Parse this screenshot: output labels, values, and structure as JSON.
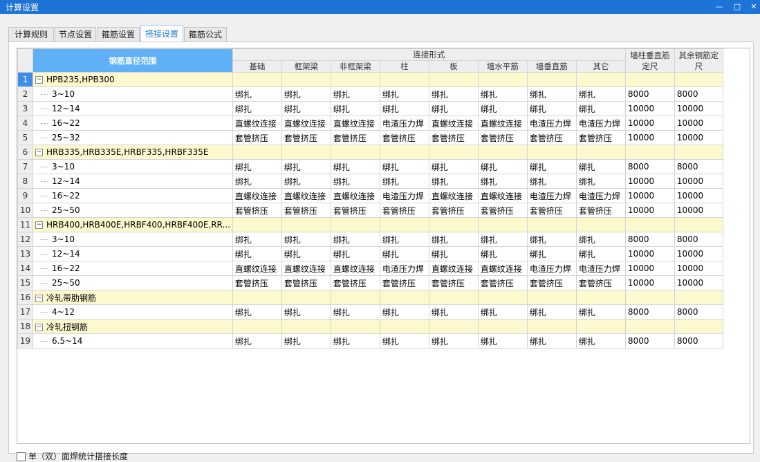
{
  "window": {
    "title": "计算设置"
  },
  "tabs": [
    {
      "label": "计算规则"
    },
    {
      "label": "节点设置"
    },
    {
      "label": "箍筋设置"
    },
    {
      "label": "搭接设置"
    },
    {
      "label": "箍筋公式"
    }
  ],
  "grid": {
    "header_range": "钢筋直径范围",
    "header_group": "连接形式",
    "header_cols": [
      "基础",
      "框架梁",
      "非框架梁",
      "柱",
      "板",
      "墙水平筋",
      "墙垂直筋",
      "其它"
    ],
    "header_wall": "墙柱垂直筋定尺",
    "header_other": "其余钢筋定尺",
    "rows": [
      {
        "n": "1",
        "type": "group",
        "label": "HPB235,HPB300"
      },
      {
        "n": "2",
        "type": "item",
        "label": "3~10",
        "cells": [
          "绑扎",
          "绑扎",
          "绑扎",
          "绑扎",
          "绑扎",
          "绑扎",
          "绑扎",
          "绑扎",
          "8000",
          "8000"
        ]
      },
      {
        "n": "3",
        "type": "item",
        "label": "12~14",
        "cells": [
          "绑扎",
          "绑扎",
          "绑扎",
          "绑扎",
          "绑扎",
          "绑扎",
          "绑扎",
          "绑扎",
          "10000",
          "10000"
        ]
      },
      {
        "n": "4",
        "type": "item",
        "label": "16~22",
        "cells": [
          "直螺纹连接",
          "直螺纹连接",
          "直螺纹连接",
          "电渣压力焊",
          "直螺纹连接",
          "直螺纹连接",
          "电渣压力焊",
          "电渣压力焊",
          "10000",
          "10000"
        ]
      },
      {
        "n": "5",
        "type": "item",
        "label": "25~32",
        "cells": [
          "套管挤压",
          "套管挤压",
          "套管挤压",
          "套管挤压",
          "套管挤压",
          "套管挤压",
          "套管挤压",
          "套管挤压",
          "10000",
          "10000"
        ]
      },
      {
        "n": "6",
        "type": "group",
        "label": "HRB335,HRB335E,HRBF335,HRBF335E"
      },
      {
        "n": "7",
        "type": "item",
        "label": "3~10",
        "cells": [
          "绑扎",
          "绑扎",
          "绑扎",
          "绑扎",
          "绑扎",
          "绑扎",
          "绑扎",
          "绑扎",
          "8000",
          "8000"
        ]
      },
      {
        "n": "8",
        "type": "item",
        "label": "12~14",
        "cells": [
          "绑扎",
          "绑扎",
          "绑扎",
          "绑扎",
          "绑扎",
          "绑扎",
          "绑扎",
          "绑扎",
          "10000",
          "10000"
        ]
      },
      {
        "n": "9",
        "type": "item",
        "label": "16~22",
        "cells": [
          "直螺纹连接",
          "直螺纹连接",
          "直螺纹连接",
          "电渣压力焊",
          "直螺纹连接",
          "直螺纹连接",
          "电渣压力焊",
          "电渣压力焊",
          "10000",
          "10000"
        ]
      },
      {
        "n": "10",
        "type": "item",
        "label": "25~50",
        "cells": [
          "套管挤压",
          "套管挤压",
          "套管挤压",
          "套管挤压",
          "套管挤压",
          "套管挤压",
          "套管挤压",
          "套管挤压",
          "10000",
          "10000"
        ]
      },
      {
        "n": "11",
        "type": "group",
        "label": "HRB400,HRB400E,HRBF400,HRBF400E,RR..."
      },
      {
        "n": "12",
        "type": "item",
        "label": "3~10",
        "cells": [
          "绑扎",
          "绑扎",
          "绑扎",
          "绑扎",
          "绑扎",
          "绑扎",
          "绑扎",
          "绑扎",
          "8000",
          "8000"
        ]
      },
      {
        "n": "13",
        "type": "item",
        "label": "12~14",
        "cells": [
          "绑扎",
          "绑扎",
          "绑扎",
          "绑扎",
          "绑扎",
          "绑扎",
          "绑扎",
          "绑扎",
          "10000",
          "10000"
        ]
      },
      {
        "n": "14",
        "type": "item",
        "label": "16~22",
        "cells": [
          "直螺纹连接",
          "直螺纹连接",
          "直螺纹连接",
          "电渣压力焊",
          "直螺纹连接",
          "直螺纹连接",
          "电渣压力焊",
          "电渣压力焊",
          "10000",
          "10000"
        ]
      },
      {
        "n": "15",
        "type": "item",
        "label": "25~50",
        "cells": [
          "套管挤压",
          "套管挤压",
          "套管挤压",
          "套管挤压",
          "套管挤压",
          "套管挤压",
          "套管挤压",
          "套管挤压",
          "10000",
          "10000"
        ]
      },
      {
        "n": "16",
        "type": "group",
        "label": "冷轧带肋钢筋"
      },
      {
        "n": "17",
        "type": "item",
        "label": "4~12",
        "cells": [
          "绑扎",
          "绑扎",
          "绑扎",
          "绑扎",
          "绑扎",
          "绑扎",
          "绑扎",
          "绑扎",
          "8000",
          "8000"
        ]
      },
      {
        "n": "18",
        "type": "group",
        "label": "冷轧扭钢筋"
      },
      {
        "n": "19",
        "type": "item",
        "label": "6.5~14",
        "cells": [
          "绑扎",
          "绑扎",
          "绑扎",
          "绑扎",
          "绑扎",
          "绑扎",
          "绑扎",
          "绑扎",
          "8000",
          "8000"
        ]
      }
    ]
  },
  "footer": {
    "checkbox_label": "单（双）面焊统计搭接长度"
  }
}
